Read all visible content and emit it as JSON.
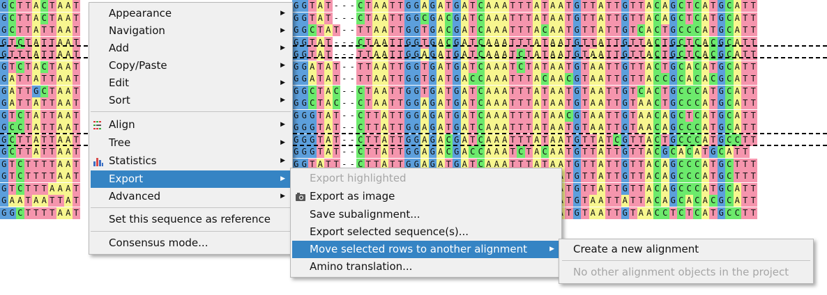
{
  "alignment": {
    "rows": [
      {
        "left": "GCTTACTAAT",
        "right": "GGTAT---CTAATTGGAGATGATCAAATTTATAATGTTATTGTTACAGCTCATGCATT"
      },
      {
        "left": "GCTTACTAAT",
        "right": "GGTAT---CTAATTGGCGACGATCAAATTTATAATGTTATTGTTACAGCTCATGCATT"
      },
      {
        "left": "GCTTATTAAT",
        "right": "GGCTAT--TTAATTGGTGACGATCAAATTTACAATGTTATTGTCACTGCCCATGCATT"
      },
      {
        "left": "GTCTATTAAT",
        "right": "GGTAT---CTAATTGGTGACGATCAAATTTATAATGTTATTGTTACTGCTCACGCATT"
      },
      {
        "left": "GTTTATTAAT",
        "right": "GGTAT---TTAATTGGAGATGATCAAATCTATAATGTAATTGTTACTGCTCACGCATT"
      },
      {
        "left": "GTCTACTAAT",
        "right": "GGATAT--TTAATTGGTGATGATCAAATCTATAATGTAATTGTTACTGCACATGCATT"
      },
      {
        "left": "GATTATTAAT",
        "right": "GGATAT--TTAATTGGTGATGACCAAATTTACAACGTAATTGTTACCGCACACGCATT"
      },
      {
        "left": "GATTGCTAAT",
        "right": "GGCTAC--CTAATTGGTGATGATCAAATTTATAATGTAATTGTCACTGCCCATGCATT"
      },
      {
        "left": "GATTATTAAT",
        "right": "GGCTAC--CTAATTGGAGATGATCAAATTTATAATGTAATTGTAACTGCCCATGCATT"
      },
      {
        "left": "GTCTATTAAT",
        "right": "GGGTAT--CTTATTGGAGATGATCAAATTTATAACGTAATTGTAACAGCTCATGCATT"
      },
      {
        "left": "GCCTATTAAT",
        "right": "GGGTAT--CTTATTGGAGATGATCAAATTTATAATGTAATTGTAACAGCCCATGCATT"
      },
      {
        "left": "GCTTATTAAT",
        "right": "GGGTAT--CTTATTGGAGACGATCAAATTTATAATGTTATCGTTACTGCCCATGCCTT"
      },
      {
        "left": "GCTTATTAAT",
        "right": "GGGTAT--CTTATTGGAGACGACCAAATCTACAATGTTATTGTTACGCACATGCATT"
      },
      {
        "left": "GTCTTTTAAT",
        "right": "GGTATT--CTTATTGGAGATGATCAAATTTATAATGTTATTGTTACAGCCCATGCTTT"
      },
      {
        "left": "GTCTTTTAAT",
        "right": "GGTATT--CTTATTGGAGATGATCAAATTTATAATGTTATTGTTACAGCCCATGCTTT"
      },
      {
        "left": "GTCTTTAAAT",
        "right": "GGTATT--CTTATTGGAGATGATCAAATTTATAATGTTATTGTTACAGCCCATGCATT"
      },
      {
        "left": "GAATAATTAT",
        "right": "GGTATT--CTTATTGGAGATGATCAAATTTATAATGTAATTATTACAGCACACGCATT"
      },
      {
        "left": "GGCTTTTAAT",
        "right": "GGTATT--CTTATTGGAGATGATCAAATTTATAATGTAATTGTAACCTCTCATGCCTT"
      }
    ],
    "colors": {
      "A": "#f7f68f",
      "C": "#6cea6c",
      "G": "#5c9fdc",
      "T": "#f595ad",
      "-": "#ffffff"
    }
  },
  "menu": {
    "items": [
      {
        "name": "appearance",
        "label": "Appearance",
        "submenu": true
      },
      {
        "name": "navigation",
        "label": "Navigation",
        "submenu": true
      },
      {
        "name": "add",
        "label": "Add",
        "submenu": true
      },
      {
        "name": "copy-paste",
        "label": "Copy/Paste",
        "submenu": true
      },
      {
        "name": "edit",
        "label": "Edit",
        "submenu": true
      },
      {
        "name": "sort",
        "label": "Sort",
        "submenu": true
      },
      {
        "name": "align",
        "label": "Align",
        "submenu": true,
        "icon": "align-icon"
      },
      {
        "name": "tree",
        "label": "Tree",
        "submenu": true
      },
      {
        "name": "statistics",
        "label": "Statistics",
        "submenu": true,
        "icon": "bar-chart-icon"
      },
      {
        "name": "export",
        "label": "Export",
        "submenu": true,
        "highlighted": true
      },
      {
        "name": "advanced",
        "label": "Advanced",
        "submenu": true
      },
      {
        "name": "set-reference",
        "label": "Set this sequence as reference"
      },
      {
        "name": "consensus-mode",
        "label": "Consensus mode..."
      }
    ]
  },
  "export_menu": {
    "items": [
      {
        "name": "export-highlighted",
        "label": "Export highlighted",
        "disabled": true
      },
      {
        "name": "export-as-image",
        "label": "Export as image",
        "icon": "camera-icon"
      },
      {
        "name": "save-subalignment",
        "label": "Save subalignment..."
      },
      {
        "name": "export-selected-sequences",
        "label": "Export selected sequence(s)..."
      },
      {
        "name": "move-rows",
        "label": "Move selected rows to another alignment",
        "submenu": true,
        "highlighted": true
      },
      {
        "name": "amino-translation",
        "label": "Amino translation..."
      }
    ]
  },
  "move_menu": {
    "items": [
      {
        "name": "create-new-alignment",
        "label": "Create a new alignment"
      },
      {
        "name": "no-other-alignments",
        "label": "No other alignment objects in the project",
        "disabled": true
      }
    ]
  }
}
